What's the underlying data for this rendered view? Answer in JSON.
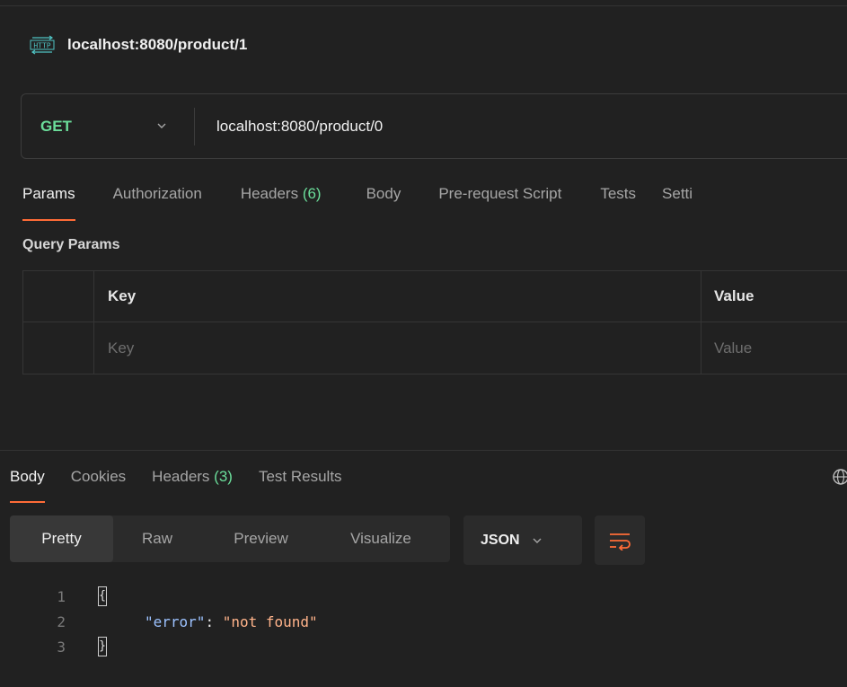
{
  "request": {
    "title": "localhost:8080/product/1",
    "icon": "http-icon"
  },
  "url_bar": {
    "method": "GET",
    "url": "localhost:8080/product/0"
  },
  "request_tabs": [
    {
      "label": "Params",
      "active": true
    },
    {
      "label": "Authorization"
    },
    {
      "label": "Headers",
      "count": "(6)"
    },
    {
      "label": "Body"
    },
    {
      "label": "Pre-request Script"
    },
    {
      "label": "Tests"
    },
    {
      "label": "Setti"
    }
  ],
  "query_params": {
    "section_label": "Query Params",
    "columns": [
      "Key",
      "Value"
    ],
    "placeholders": {
      "key": "Key",
      "value": "Value"
    }
  },
  "response_tabs": [
    {
      "label": "Body",
      "active": true
    },
    {
      "label": "Cookies"
    },
    {
      "label": "Headers",
      "count": "(3)"
    },
    {
      "label": "Test Results"
    }
  ],
  "view_modes": [
    "Pretty",
    "Raw",
    "Preview",
    "Visualize"
  ],
  "active_view_mode": "Pretty",
  "format": "JSON",
  "response_body": {
    "lines": [
      {
        "num": "1",
        "text": "{"
      },
      {
        "num": "2",
        "key": "\"error\"",
        "sep": ": ",
        "value": "\"not found\""
      },
      {
        "num": "3",
        "text": "}"
      }
    ]
  },
  "colors": {
    "accent": "#ff6c37",
    "method_get": "#6bdd9a",
    "count": "#6bdd9a",
    "background": "#212121"
  }
}
